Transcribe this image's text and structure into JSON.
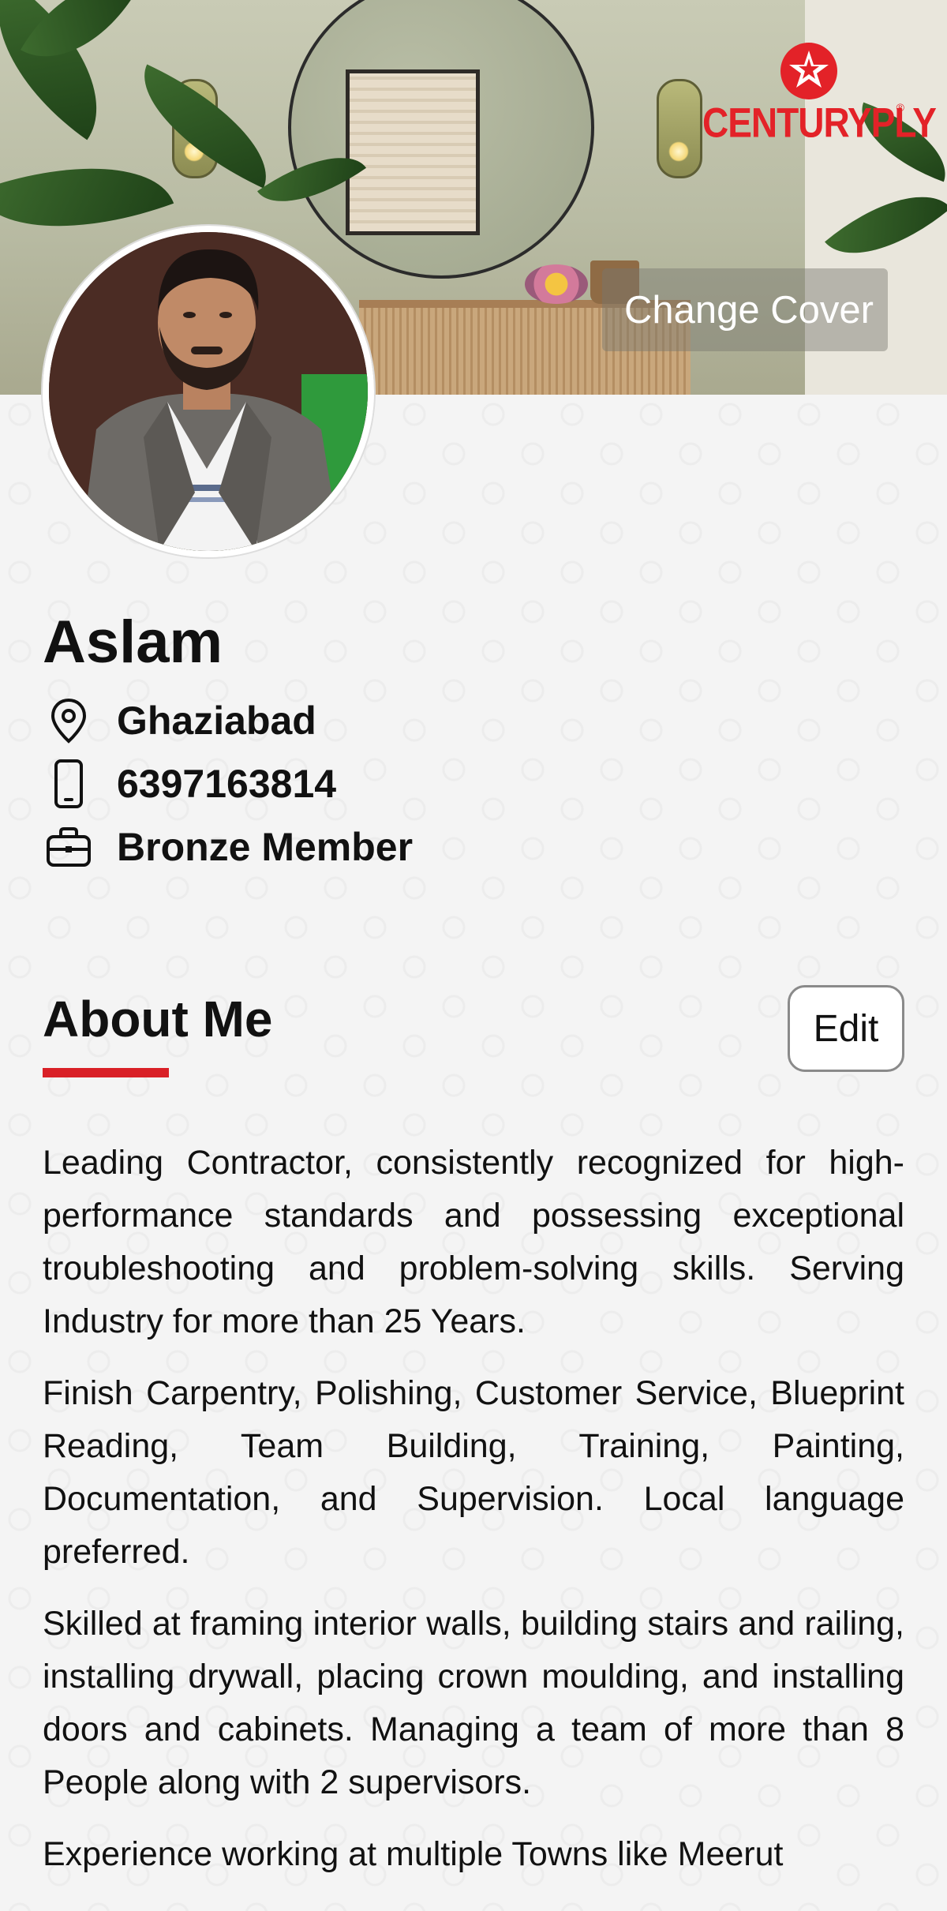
{
  "cover": {
    "brand_name": "CENTURYPLY",
    "brand_reg": "®",
    "change_cover_label": "Change Cover"
  },
  "profile": {
    "name": "Aslam",
    "location": "Ghaziabad",
    "phone": "6397163814",
    "membership": "Bronze Member"
  },
  "about": {
    "title": "About Me",
    "edit_label": "Edit",
    "paragraphs": [
      "Leading Contractor, consistently recognized for high-performance standards and possessing exceptional troubleshooting and problem-solving skills. Serving Industry for more than 25 Years.",
      "Finish Carpentry, Polishing, Customer Service, Blueprint Reading, Team Building, Training, Painting, Documentation, and Supervision. Local language preferred.",
      "Skilled at framing interior walls, building stairs and railing, installing drywall, placing crown moulding, and installing doors and cabinets. Managing a team of more than 8 People along with 2 supervisors.",
      "Experience working at multiple Towns like Meerut"
    ]
  },
  "icons": {
    "location": "map-pin-icon",
    "phone": "smartphone-icon",
    "membership": "briefcase-icon"
  },
  "colors": {
    "accent": "#d92027",
    "brand": "#e32228"
  }
}
